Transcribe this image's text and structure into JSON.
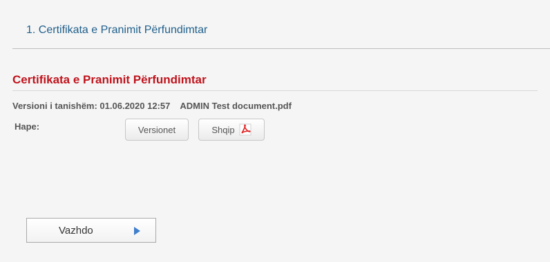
{
  "step": {
    "title": "1. Certifikata e Pranimit Përfundimtar"
  },
  "section": {
    "title": "Certifikata e Pranimit Përfundimtar",
    "current_version_label": "Versioni i tanishëm: 01.06.2020 12:57",
    "author": "ADMIN",
    "file_name": "Test document.pdf",
    "open_label": "Hape:",
    "versions_button": "Versionet",
    "language_button": "Shqip",
    "file_icon": "pdf-icon"
  },
  "footer": {
    "continue_label": "Vazhdo",
    "continue_icon": "arrow-right-icon"
  },
  "colors": {
    "title_blue": "#1f5f8b",
    "section_red": "#c0141d",
    "arrow_blue": "#3f7fcc"
  }
}
